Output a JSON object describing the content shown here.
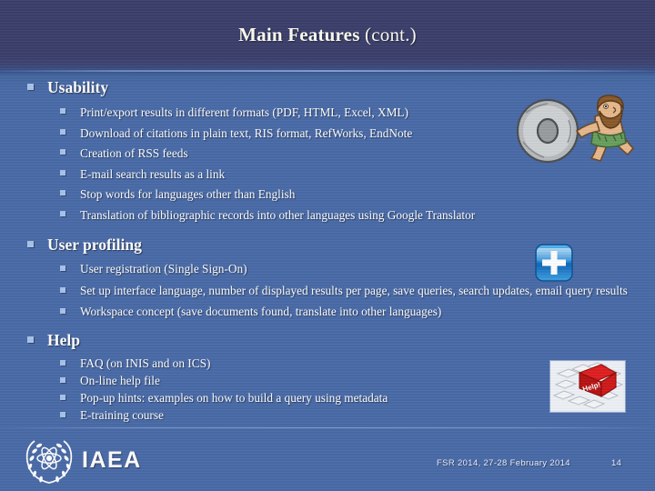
{
  "slide": {
    "title_main": "Main Features",
    "title_cont": "(cont.)",
    "background_color": "#4a6ba8",
    "header_color": "#3b3f6b",
    "bullet_color": "#a8c4ea",
    "text_color": "#ffffff"
  },
  "sections": [
    {
      "heading": "Usability",
      "items": [
        "Print/export results in different formats (PDF, HTML, Excel, XML)",
        "Download of citations in plain text, RIS format, RefWorks,  EndNote",
        "Creation of RSS feeds",
        "E-mail search results as a link",
        "Stop words for languages other than English",
        "Translation of bibliographic records into other languages using Google Translator"
      ]
    },
    {
      "heading": "User profiling",
      "items": [
        "User registration (Single Sign-On)",
        "Set up interface language, number of displayed results per page, save queries, search updates, email query results",
        "Workspace concept (save documents found, translate into other languages)"
      ]
    },
    {
      "heading": "Help",
      "items": [
        "FAQ (on INIS and on ICS)",
        "On-line help file",
        "Pop-up hints: examples on how to build a query using metadata",
        "E-training course"
      ]
    }
  ],
  "clipart": [
    {
      "name": "caveman-stone-wheel-image",
      "alt": "Cartoon caveman pushing a stone wheel"
    },
    {
      "name": "blue-plus-button-image",
      "alt": "Glossy blue rounded square button with white plus sign"
    },
    {
      "name": "help-keyboard-key-image",
      "alt": "Keyboard with a red Help! key",
      "key_label": "Help!"
    }
  ],
  "footer": {
    "organization": "IAEA",
    "note": "FSR 2014, 27-28 February 2014",
    "slide_number": "14"
  }
}
